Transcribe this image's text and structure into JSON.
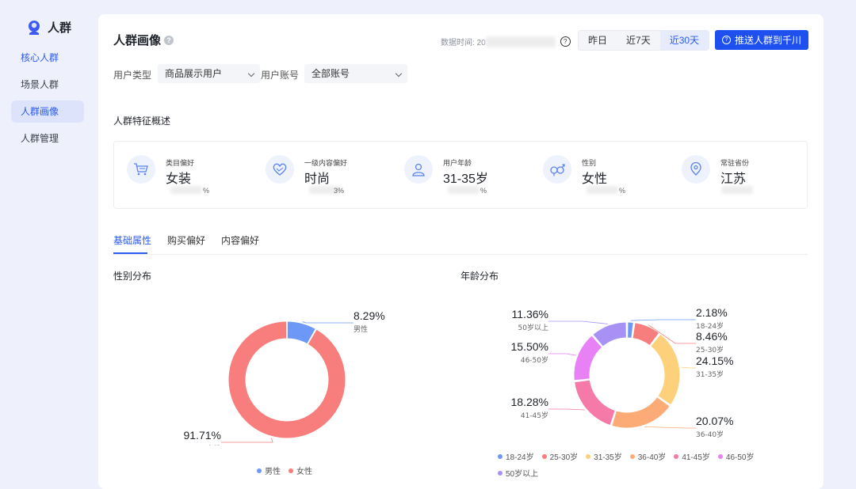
{
  "sidebar": {
    "title": "人群",
    "items": [
      {
        "label": "核心人群"
      },
      {
        "label": "场景人群"
      },
      {
        "label": "人群画像"
      },
      {
        "label": "人群管理"
      }
    ]
  },
  "header": {
    "title": "人群画像",
    "data_time_label": "数据时间: 20",
    "ranges": [
      "昨日",
      "近7天",
      "近30天"
    ],
    "active_range": "近30天",
    "push_button": "推送人群到千川"
  },
  "filters": {
    "user_type_label": "用户类型",
    "user_type_value": "商品展示用户",
    "account_label": "用户账号",
    "account_value": "全部账号"
  },
  "overview": {
    "title": "人群特征概述",
    "cards": [
      {
        "label": "类目偏好",
        "value": "女装",
        "pct": "%",
        "icon": "cart-icon"
      },
      {
        "label": "一级内容偏好",
        "value": "时尚",
        "pct": "3%",
        "icon": "heart-icon"
      },
      {
        "label": "用户年龄",
        "value": "31-35岁",
        "pct": "%",
        "icon": "user-icon"
      },
      {
        "label": "性别",
        "value": "女性",
        "pct": "%",
        "icon": "gender-icon"
      },
      {
        "label": "常驻省份",
        "value": "江苏",
        "pct": "",
        "icon": "location-icon"
      }
    ]
  },
  "tabs": [
    {
      "label": "基础属性"
    },
    {
      "label": "购买偏好"
    },
    {
      "label": "内容偏好"
    }
  ],
  "gender_chart": {
    "title": "性别分布",
    "chart_data": {
      "type": "pie",
      "slices": [
        {
          "name": "男性",
          "value": 8.29,
          "label": "8.29%",
          "color": "#6e98f7"
        },
        {
          "name": "女性",
          "value": 91.71,
          "label": "91.71%",
          "color": "#f87d7d"
        }
      ],
      "legend": [
        "男性",
        "女性"
      ]
    }
  },
  "age_chart": {
    "title": "年龄分布",
    "chart_data": {
      "type": "pie",
      "slices": [
        {
          "name": "18-24岁",
          "value": 2.18,
          "label": "2.18%",
          "color": "#6e98f7"
        },
        {
          "name": "25-30岁",
          "value": 8.46,
          "label": "8.46%",
          "color": "#f87d7d"
        },
        {
          "name": "31-35岁",
          "value": 24.15,
          "label": "24.15%",
          "color": "#fdd17b"
        },
        {
          "name": "36-40岁",
          "value": 20.07,
          "label": "20.07%",
          "color": "#fcab77"
        },
        {
          "name": "41-45岁",
          "value": 18.28,
          "label": "18.28%",
          "color": "#f57aa8"
        },
        {
          "name": "46-50岁",
          "value": 15.5,
          "label": "15.50%",
          "color": "#e881f5"
        },
        {
          "name": "50岁以上",
          "value": 11.36,
          "label": "11.36%",
          "color": "#a791f5"
        }
      ],
      "legend": [
        "18-24岁",
        "25-30岁",
        "31-35岁",
        "36-40岁",
        "41-45岁",
        "46-50岁",
        "50岁以上"
      ]
    }
  }
}
